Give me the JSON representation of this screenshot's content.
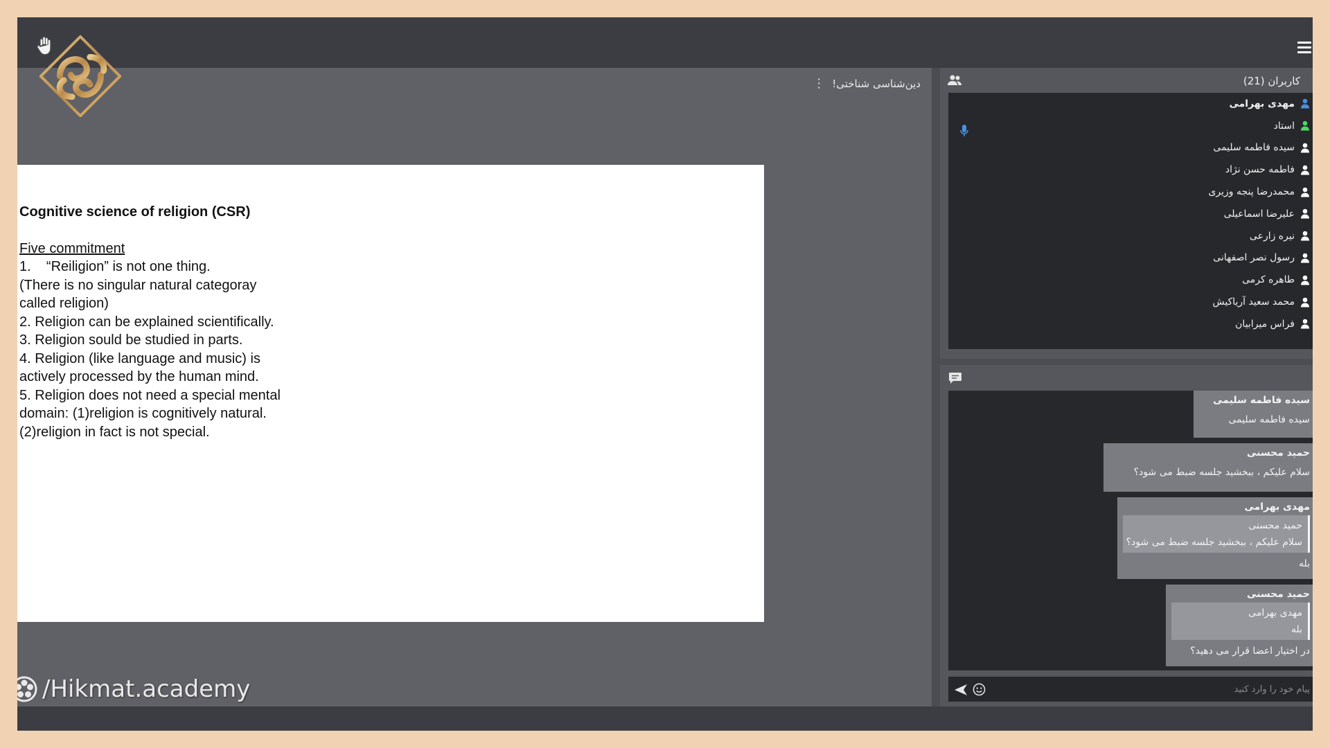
{
  "stage": {
    "title": "دین‌شناسی شناختی!"
  },
  "slide": {
    "title": "Cognitive science of religion (CSR)",
    "subtitle": "Five commitment",
    "lines": [
      "1.    “Reiligion” is not one thing.",
      "(There is no singular natural categoray",
      "called religion)",
      "2. Religion can be explained scientifically.",
      "3. Religion sould be studied in parts.",
      "4. Religion (like language and music) is",
      "actively processed by the human mind.",
      "5. Religion does not need a special mental",
      "domain: (1)religion is cognitively natural.",
      "(2)religion in fact is not special."
    ]
  },
  "watermark": {
    "text": "/Hikmat.academy"
  },
  "users": {
    "title": "کاربران (21)",
    "list": [
      {
        "name": "مهدی بهرامی",
        "color": "#4a90e2"
      },
      {
        "name": "استاد",
        "color": "#4cd964"
      },
      {
        "name": "سیده فاطمه سلیمی",
        "color": "#ffffff"
      },
      {
        "name": "فاطمه حسن نژاد",
        "color": "#ffffff"
      },
      {
        "name": "محمدرضا پنجه وزیری",
        "color": "#ffffff"
      },
      {
        "name": "علیرضا اسماعیلی",
        "color": "#ffffff"
      },
      {
        "name": "نیره زارعی",
        "color": "#ffffff"
      },
      {
        "name": "رسول نصر اصفهانی",
        "color": "#ffffff"
      },
      {
        "name": "طاهره کرمی",
        "color": "#ffffff"
      },
      {
        "name": "محمد سعید آریاکیش",
        "color": "#ffffff"
      },
      {
        "name": "فراس میرابیان",
        "color": "#ffffff"
      }
    ]
  },
  "chat": {
    "messages": [
      {
        "author": "سیده فاطمه سلیمی",
        "text": "سیده فاطمه سلیمی"
      },
      {
        "author": "حمید محسنی",
        "text": "سلام علیکم ، ببخشید جلسه ضبط می شود؟"
      },
      {
        "author": "مهدی بهرامی",
        "quote_author": "حمید محسنی",
        "quote_text": "سلام علیکم ، ببخشید جلسه ضبط می شود؟",
        "text": "بله"
      },
      {
        "author": "حمید محسنی",
        "quote_author": "مهدی بهرامی",
        "quote_text": "بله",
        "text": "در اختیار اعضا قرار می دهید؟"
      }
    ],
    "input_placeholder": "پیام خود را وارد کنید"
  },
  "colors": {
    "accent_blue": "#4a90e2",
    "accent_green": "#4cd964",
    "logo_gold": "#c9a05a"
  }
}
